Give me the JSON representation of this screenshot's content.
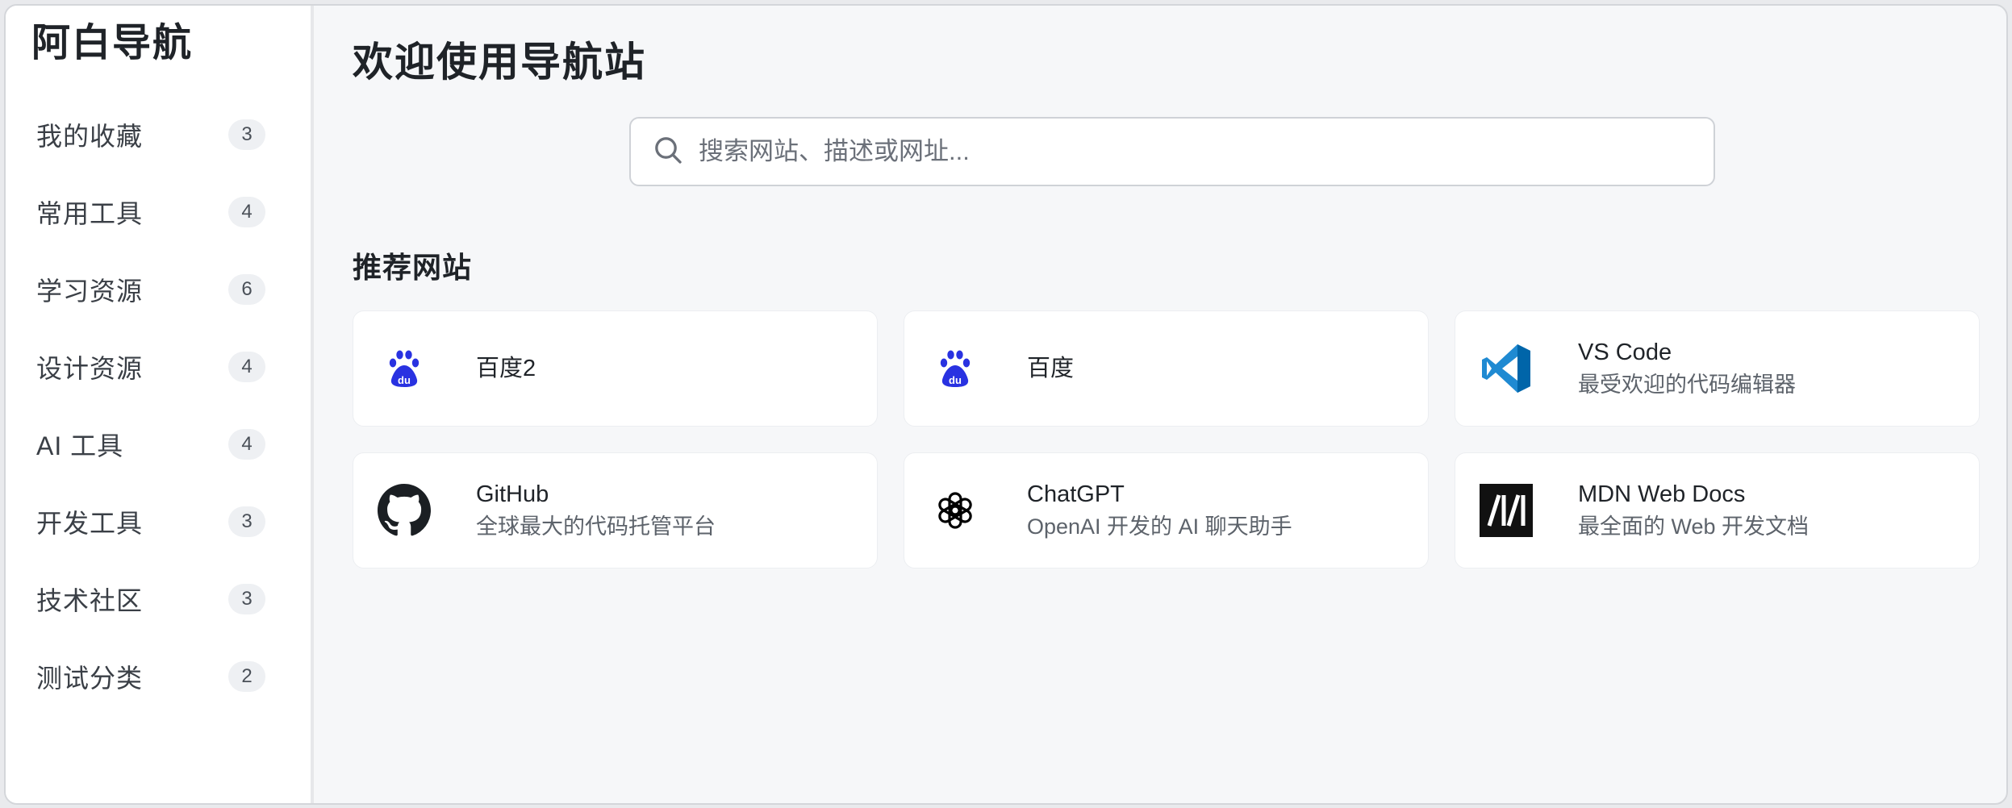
{
  "sidebar": {
    "brand": "阿白导航",
    "items": [
      {
        "label": "我的收藏",
        "count": "3"
      },
      {
        "label": "常用工具",
        "count": "4"
      },
      {
        "label": "学习资源",
        "count": "6"
      },
      {
        "label": "设计资源",
        "count": "4"
      },
      {
        "label": "AI 工具",
        "count": "4"
      },
      {
        "label": "开发工具",
        "count": "3"
      },
      {
        "label": "技术社区",
        "count": "3"
      },
      {
        "label": "测试分类",
        "count": "2"
      }
    ]
  },
  "main": {
    "title": "欢迎使用导航站",
    "search": {
      "placeholder": "搜索网站、描述或网址...",
      "icon": "search-icon"
    },
    "section_title": "推荐网站",
    "cards": [
      {
        "name": "百度2",
        "desc": "",
        "icon": "baidu-icon",
        "color": "#2932e1"
      },
      {
        "name": "百度",
        "desc": "",
        "icon": "baidu-icon",
        "color": "#2932e1"
      },
      {
        "name": "VS Code",
        "desc": "最受欢迎的代码编辑器",
        "icon": "vscode-icon",
        "color": "#0a7acc"
      },
      {
        "name": "GitHub",
        "desc": "全球最大的代码托管平台",
        "icon": "github-icon",
        "color": "#1b1f23"
      },
      {
        "name": "ChatGPT",
        "desc": "OpenAI 开发的 AI 聊天助手",
        "icon": "openai-icon",
        "color": "#000000"
      },
      {
        "name": "MDN Web Docs",
        "desc": "最全面的 Web 开发文档",
        "icon": "mdn-icon",
        "color": "#111111"
      }
    ]
  }
}
